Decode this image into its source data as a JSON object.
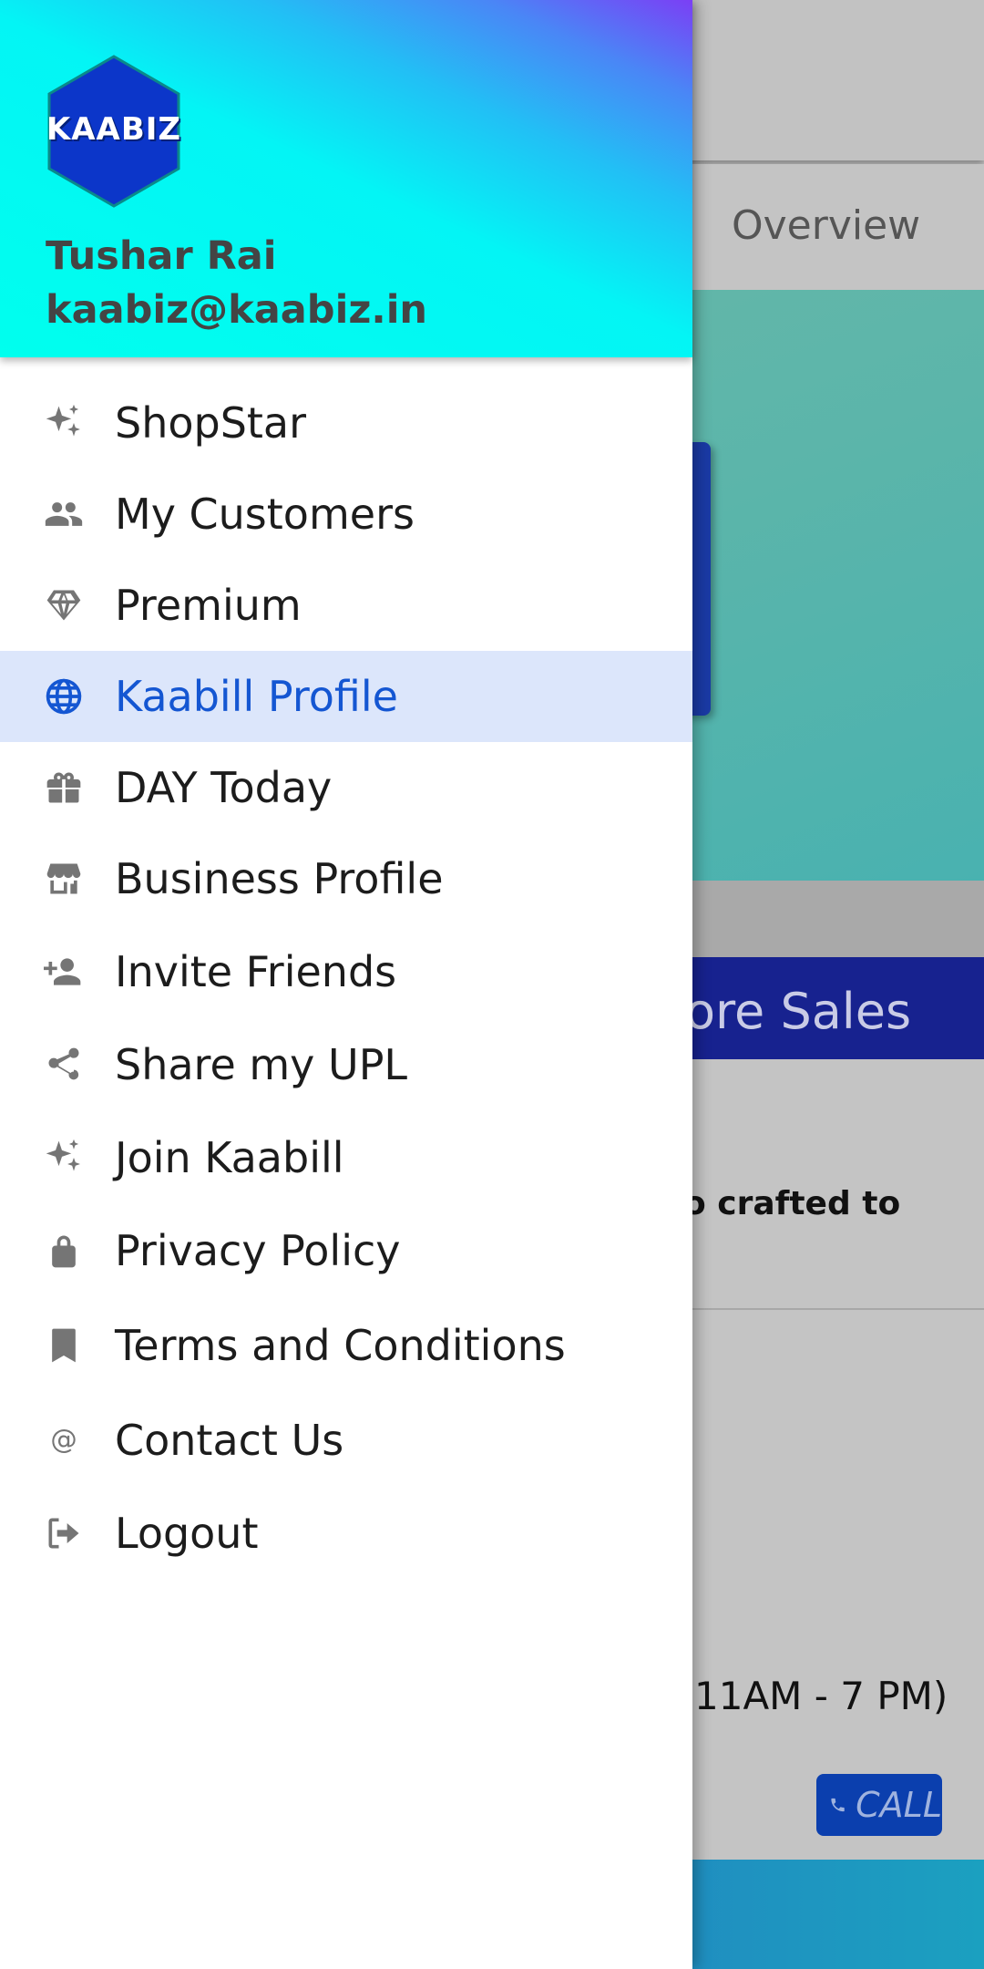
{
  "background": {
    "tab_overview": "Overview",
    "sales_text": "ore Sales",
    "crafted_text": "o crafted to",
    "hours_text": "11AM - 7 PM)",
    "call_label": "CALL"
  },
  "drawer": {
    "logo_text": "KAABIZ",
    "user_name": "Tushar Rai",
    "user_email": "kaabiz@kaabiz.in",
    "active_item": "Kaabill Profile",
    "items": [
      {
        "label": "ShopStar",
        "icon": "sparkle-icon"
      },
      {
        "label": "My Customers",
        "icon": "people-icon"
      },
      {
        "label": "Premium",
        "icon": "diamond-icon"
      },
      {
        "label": "Kaabill Profile",
        "icon": "globe-icon"
      },
      {
        "label": "DAY Today",
        "icon": "gift-icon"
      },
      {
        "label": "Business Profile",
        "icon": "store-icon"
      },
      {
        "label": "Invite Friends",
        "icon": "person-add-icon"
      },
      {
        "label": "Share my UPL",
        "icon": "share-icon"
      },
      {
        "label": "Join Kaabill",
        "icon": "sparkle-icon"
      },
      {
        "label": "Privacy Policy",
        "icon": "lock-icon"
      },
      {
        "label": "Terms and Conditions",
        "icon": "bookmark-icon"
      },
      {
        "label": "Contact Us",
        "icon": "at-icon"
      },
      {
        "label": "Logout",
        "icon": "logout-icon"
      }
    ]
  },
  "colors": {
    "active_text": "#1456d2",
    "active_bg": "#dce6fb",
    "icon_gray": "#757575"
  }
}
